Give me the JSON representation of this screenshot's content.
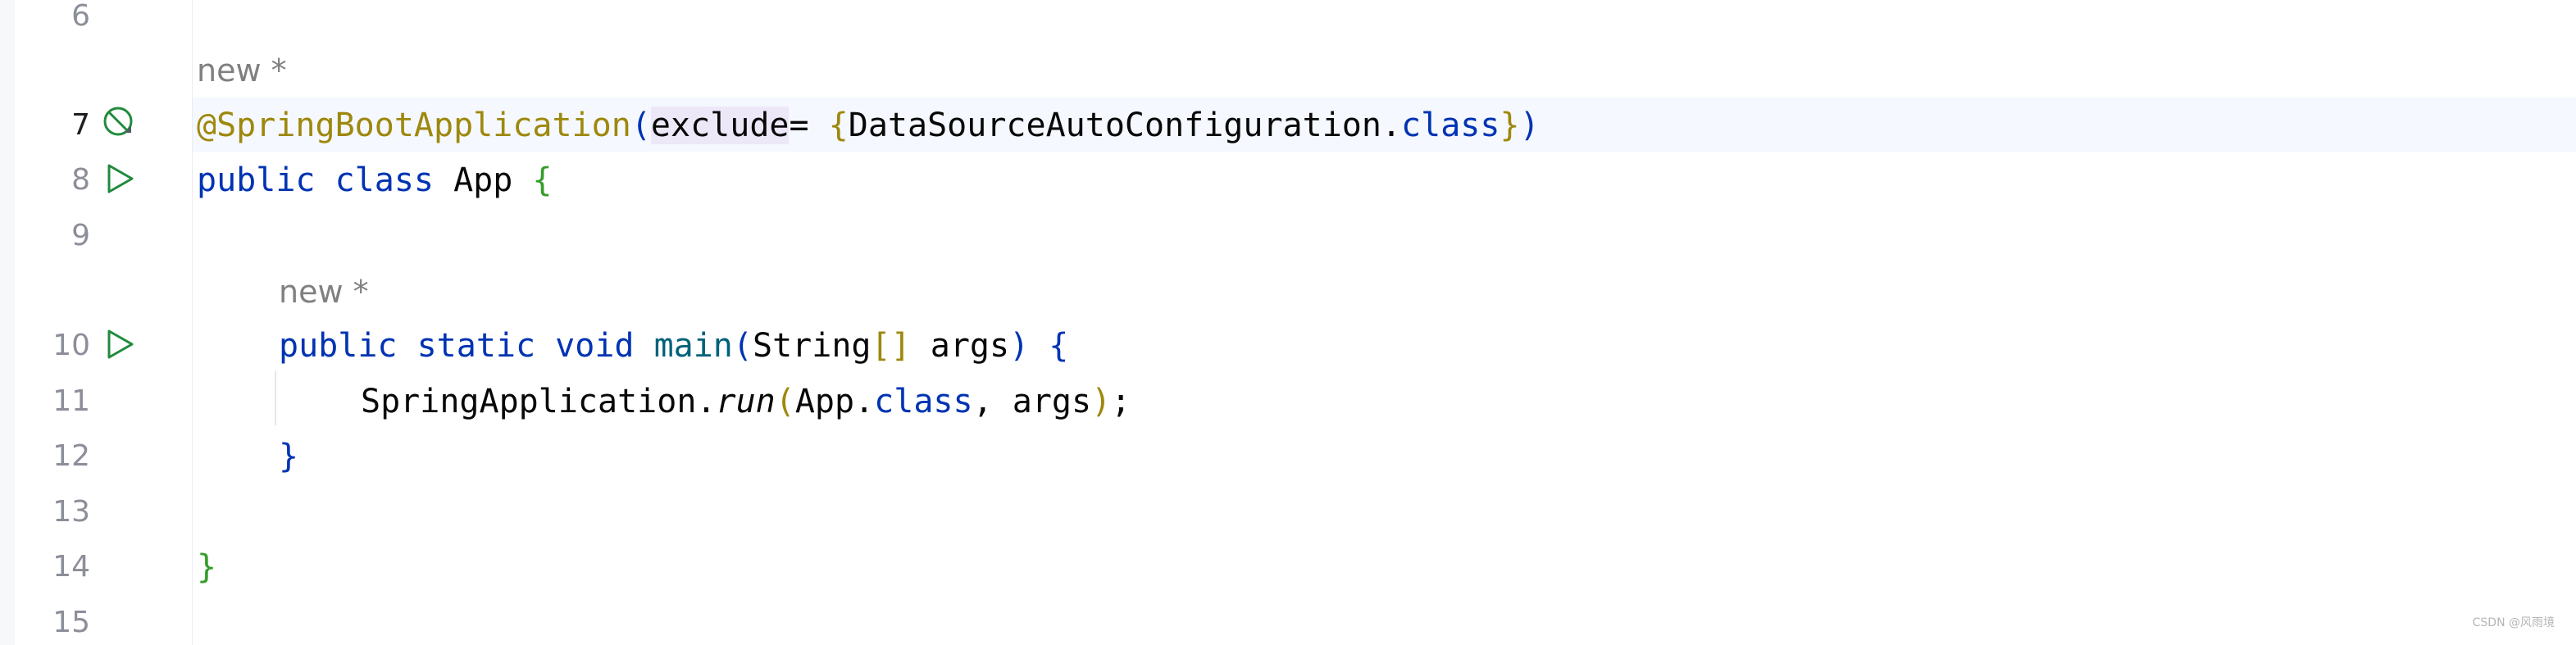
{
  "editor": {
    "line_numbers": [
      "6",
      "7",
      "8",
      "9",
      "10",
      "11",
      "12",
      "13",
      "14",
      "15"
    ],
    "hint_class": "new *",
    "hint_method": "new *",
    "code": {
      "l7_ann": "@SpringBootApplication",
      "l7_open": "(",
      "l7_param": "exclude",
      "l7_eq": "= ",
      "l7_brace_open": "{",
      "l7_type": "DataSourceAutoConfiguration.",
      "l7_class": "class",
      "l7_brace_close": "}",
      "l7_close": ")",
      "l8_kw": "public class ",
      "l8_name": "App ",
      "l8_brace": "{",
      "l10_kw": "public static void ",
      "l10_name": "main",
      "l10_open": "(",
      "l10_type": "String",
      "l10_arr": "[]",
      "l10_arg": " args",
      "l10_close": ") ",
      "l10_brace": "{",
      "l11_obj": "SpringApplication.",
      "l11_method": "run",
      "l11_open": "(",
      "l11_arg1": "App.",
      "l11_class": "class",
      "l11_rest": ", args",
      "l11_close": ")",
      "l11_semi": ";",
      "l12_brace": "}",
      "l14_brace": "}"
    },
    "colors": {
      "keyword": "#0033b3",
      "annotation": "#9e880d",
      "brace_green": "#359e2b",
      "current_line_bg": "#f5f8fe",
      "run_icon": "#208a3c"
    },
    "icons": [
      "spring-boot-disabled-icon",
      "run-icon",
      "run-icon"
    ]
  },
  "watermark": "CSDN @风雨境"
}
